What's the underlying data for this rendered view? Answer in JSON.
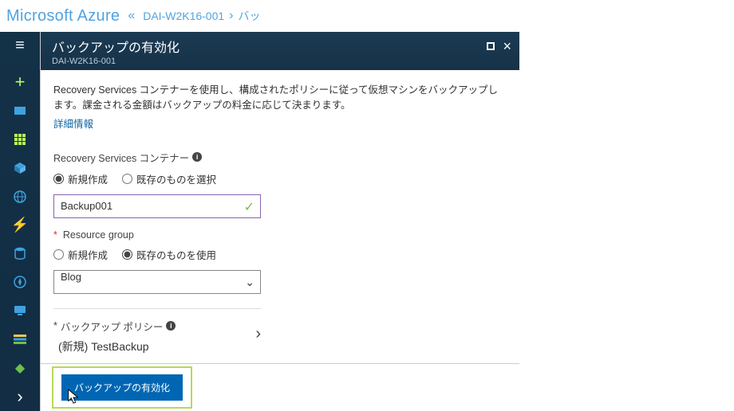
{
  "header": {
    "brand": "Microsoft Azure",
    "breadcrumb_root": "DAI-W2K16-001",
    "breadcrumb_truncated": "バッ"
  },
  "leftnav": {
    "items": [
      "plus",
      "dashboard",
      "all-services",
      "cube",
      "globe",
      "bolt",
      "sql",
      "compass",
      "monitor",
      "list",
      "diamond",
      "chevron"
    ]
  },
  "blade": {
    "title": "バックアップの有効化",
    "subtitle": "DAI-W2K16-001",
    "intro": "Recovery Services コンテナーを使用し、構成されたポリシーに従って仮想マシンをバックアップします。課金される金額はバックアップの料金に応じて決まります。",
    "details_link": "詳細情報",
    "container_label": "Recovery Services コンテナー",
    "container_radio_new": "新規作成",
    "container_radio_existing": "既存のものを選択",
    "container_name_value": "Backup001",
    "rg_label": "Resource group",
    "rg_radio_new": "新規作成",
    "rg_radio_existing": "既存のものを使用",
    "rg_selected": "Blog",
    "policy_label": "バックアップ ポリシー",
    "policy_value": "(新規) TestBackup",
    "enable_button": "バックアップの有効化"
  }
}
